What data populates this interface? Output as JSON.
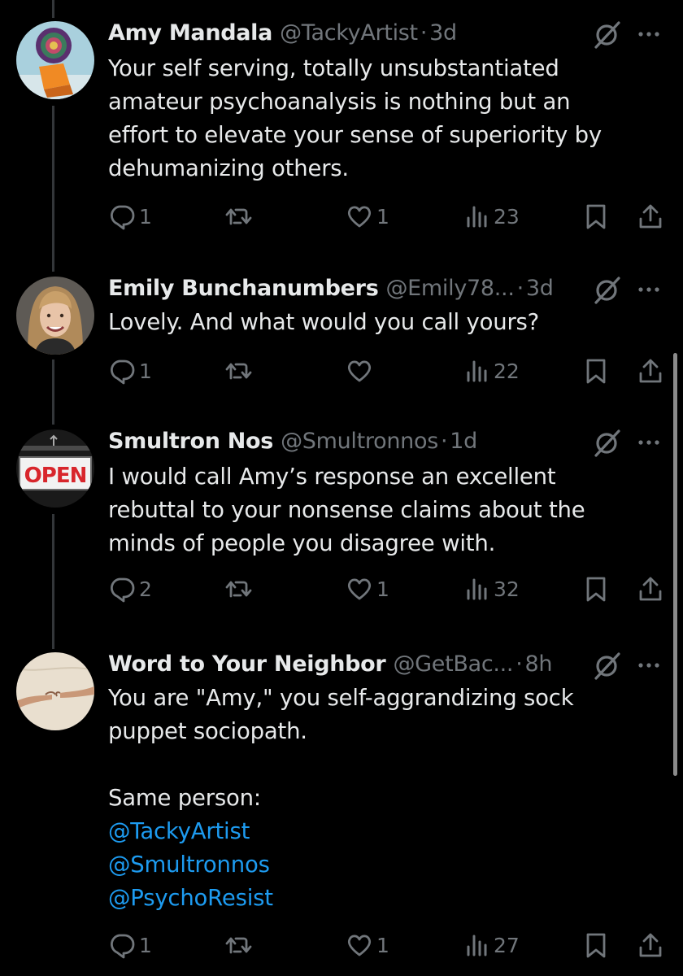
{
  "tweets": [
    {
      "name": "Amy Mandala",
      "handle": "@TackyArtist",
      "separator": "·",
      "time": "3d",
      "lines": [
        "Your self serving, totally unsubstantiated",
        "amateur psychoanalysis is nothing but an",
        "effort to elevate your sense of superiority by",
        "dehumanizing others."
      ],
      "replies": "1",
      "retweets": "",
      "likes": "1",
      "views": "23",
      "avatar": "mandala-and-orange-chair"
    },
    {
      "name": "Emily Bunchanumbers",
      "handle": "@Emily78...",
      "separator": "·",
      "time": "3d",
      "lines": [
        "Lovely. And what would you call yours?"
      ],
      "replies": "1",
      "retweets": "",
      "likes": "",
      "views": "22",
      "avatar": "smiling-woman-portrait"
    },
    {
      "name": "Smultron Nos",
      "handle": "@Smultronnos",
      "separator": "·",
      "time": "1d",
      "lines": [
        "I would call Amy’s response an excellent",
        "rebuttal to your nonsense claims about the",
        "minds of people you disagree with."
      ],
      "replies": "2",
      "retweets": "",
      "likes": "1",
      "views": "32",
      "avatar": "open-sign",
      "avatar_text": "OPEN"
    },
    {
      "name": "Word to Your Neighbor",
      "handle": "@GetBac...",
      "separator": "·",
      "time": "8h",
      "lines": [
        "You are \"Amy,\" you self-aggrandizing sock",
        "puppet sociopath.",
        "",
        "Same person:"
      ],
      "mentions": [
        "@TackyArtist",
        "@Smultronnos",
        "@PsychoResist"
      ],
      "replies": "1",
      "retweets": "",
      "likes": "1",
      "views": "27",
      "avatar": "creation-of-adam-hands"
    }
  ],
  "icons": {
    "reply": "reply-icon",
    "retweet": "retweet-icon",
    "like": "like-icon",
    "views": "views-icon",
    "bookmark": "bookmark-icon",
    "share": "share-icon",
    "grok": "grok-icon",
    "more": "more-icon"
  },
  "colors": {
    "background": "#000000",
    "text": "#e7e9ea",
    "secondary": "#71767b",
    "link": "#1d9bf0",
    "thread_line": "#333639"
  }
}
